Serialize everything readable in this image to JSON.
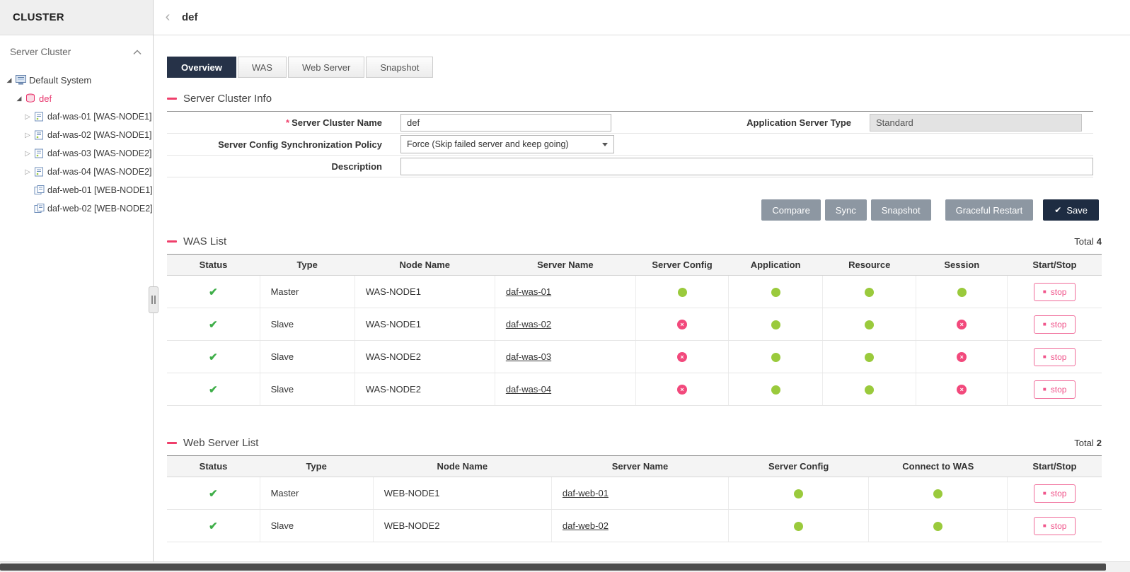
{
  "colors": {
    "accent": "#ef3f6b",
    "green_dot": "#9aca3c",
    "check_green": "#3fae49",
    "error_pink": "#f2497c",
    "save_navy": "#1e2c42",
    "button_gray": "#8d97a2",
    "active_tab": "#263248"
  },
  "icons": {
    "back_chevron": "‹",
    "check": "✔",
    "error_x": "×",
    "twisty_expanded": "◢",
    "twisty_collapsed": "▷",
    "stop_square": "■",
    "save_check": "✔"
  },
  "sidebar": {
    "title": "CLUSTER",
    "section_label": "Server Cluster",
    "tree": {
      "root_label": "Default System",
      "cluster_label": "def",
      "items": [
        {
          "label": "daf-was-01 [WAS-NODE1]"
        },
        {
          "label": "daf-was-02 [WAS-NODE1]"
        },
        {
          "label": "daf-was-03 [WAS-NODE2]"
        },
        {
          "label": "daf-was-04 [WAS-NODE2]"
        },
        {
          "label": "daf-web-01 [WEB-NODE1]"
        },
        {
          "label": "daf-web-02 [WEB-NODE2]"
        }
      ]
    }
  },
  "header": {
    "title": "def"
  },
  "tabs": [
    {
      "label": "Overview"
    },
    {
      "label": "WAS"
    },
    {
      "label": "Web Server"
    },
    {
      "label": "Snapshot"
    }
  ],
  "cluster_info": {
    "section_title": "Server Cluster Info",
    "required_mark": "*",
    "fields": {
      "server_cluster_name": {
        "label": "Server Cluster Name",
        "value": "def"
      },
      "application_server_type": {
        "label": "Application Server Type",
        "value": "Standard"
      },
      "sync_policy": {
        "label": "Server Config Synchronization Policy",
        "value": "Force (Skip failed server and keep going)"
      },
      "description": {
        "label": "Description",
        "value": ""
      }
    },
    "buttons": {
      "compare": "Compare",
      "sync": "Sync",
      "snapshot": "Snapshot",
      "graceful_restart": "Graceful Restart",
      "save": "Save"
    }
  },
  "was_list": {
    "section_title": "WAS List",
    "total_label": "Total",
    "total_value": "4",
    "columns": [
      "Status",
      "Type",
      "Node Name",
      "Server Name",
      "Server Config",
      "Application",
      "Resource",
      "Session",
      "Start/Stop"
    ],
    "rows": [
      {
        "status": "ok",
        "type": "Master",
        "node_name": "WAS-NODE1",
        "server_name": "daf-was-01",
        "server_config": "ok",
        "application": "ok",
        "resource": "ok",
        "session": "ok",
        "action": "stop"
      },
      {
        "status": "ok",
        "type": "Slave",
        "node_name": "WAS-NODE1",
        "server_name": "daf-was-02",
        "server_config": "error",
        "application": "ok",
        "resource": "ok",
        "session": "error",
        "action": "stop"
      },
      {
        "status": "ok",
        "type": "Slave",
        "node_name": "WAS-NODE2",
        "server_name": "daf-was-03",
        "server_config": "error",
        "application": "ok",
        "resource": "ok",
        "session": "error",
        "action": "stop"
      },
      {
        "status": "ok",
        "type": "Slave",
        "node_name": "WAS-NODE2",
        "server_name": "daf-was-04",
        "server_config": "error",
        "application": "ok",
        "resource": "ok",
        "session": "error",
        "action": "stop"
      }
    ]
  },
  "web_server_list": {
    "section_title": "Web Server List",
    "total_label": "Total",
    "total_value": "2",
    "columns": [
      "Status",
      "Type",
      "Node Name",
      "Server Name",
      "Server Config",
      "Connect to WAS",
      "Start/Stop"
    ],
    "rows": [
      {
        "status": "ok",
        "type": "Master",
        "node_name": "WEB-NODE1",
        "server_name": "daf-web-01",
        "server_config": "ok",
        "connect_to_was": "ok",
        "action": "stop"
      },
      {
        "status": "ok",
        "type": "Slave",
        "node_name": "WEB-NODE2",
        "server_name": "daf-web-02",
        "server_config": "ok",
        "connect_to_was": "ok",
        "action": "stop"
      }
    ]
  }
}
